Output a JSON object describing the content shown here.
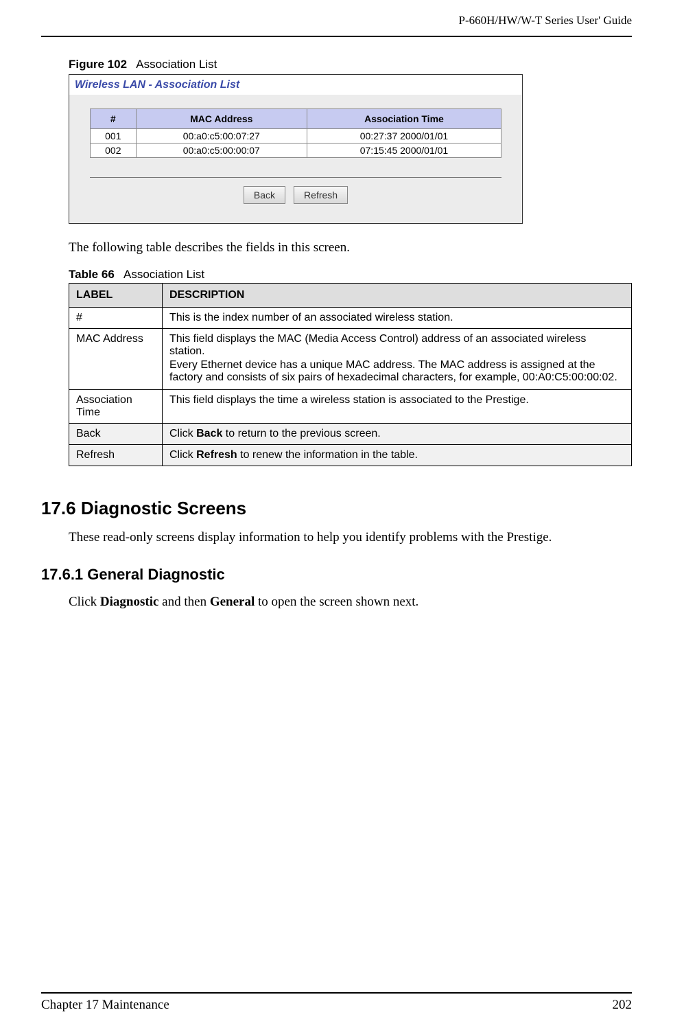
{
  "header": {
    "guide_title": "P-660H/HW/W-T Series User' Guide"
  },
  "figure": {
    "number": "Figure 102",
    "title": "Association List"
  },
  "screenshot": {
    "panel_title": "Wireless LAN - Association List",
    "columns": {
      "c1": "#",
      "c2": "MAC Address",
      "c3": "Association Time"
    },
    "rows": [
      {
        "idx": "001",
        "mac": "00:a0:c5:00:07:27",
        "time": "00:27:37 2000/01/01"
      },
      {
        "idx": "002",
        "mac": "00:a0:c5:00:00:07",
        "time": "07:15:45 2000/01/01"
      }
    ],
    "buttons": {
      "back": "Back",
      "refresh": "Refresh"
    }
  },
  "intro_text": "The following table describes the fields in this screen.",
  "table": {
    "number": "Table 66",
    "title": "Association List",
    "head": {
      "label": "LABEL",
      "desc": "DESCRIPTION"
    },
    "rows": {
      "r1": {
        "label": "#",
        "desc": "This is the index number of an associated wireless station."
      },
      "r2": {
        "label": "MAC Address",
        "desc_p1": "This field displays the MAC (Media Access Control) address of an associated wireless station.",
        "desc_p2": "Every Ethernet device has a unique MAC address. The MAC address is assigned at the factory and consists of six pairs of hexadecimal characters, for example, 00:A0:C5:00:00:02."
      },
      "r3": {
        "label": "Association Time",
        "desc": "This field displays the time a wireless station is associated to the Prestige."
      },
      "r4": {
        "label": "Back",
        "desc_pre": "Click ",
        "desc_bold": "Back",
        "desc_post": " to return to the previous screen."
      },
      "r5": {
        "label": "Refresh",
        "desc_pre": "Click ",
        "desc_bold": "Refresh",
        "desc_post": " to renew the information in the table."
      }
    }
  },
  "section_176": {
    "heading": "17.6  Diagnostic Screens",
    "text": "These read-only screens display information to help you identify problems with the Prestige."
  },
  "section_1761": {
    "heading": "17.6.1  General Diagnostic",
    "text_pre": "Click ",
    "text_b1": "Diagnostic",
    "text_mid": " and then ",
    "text_b2": "General",
    "text_post": " to open the screen shown next."
  },
  "footer": {
    "chapter": "Chapter 17 Maintenance",
    "page": "202"
  }
}
